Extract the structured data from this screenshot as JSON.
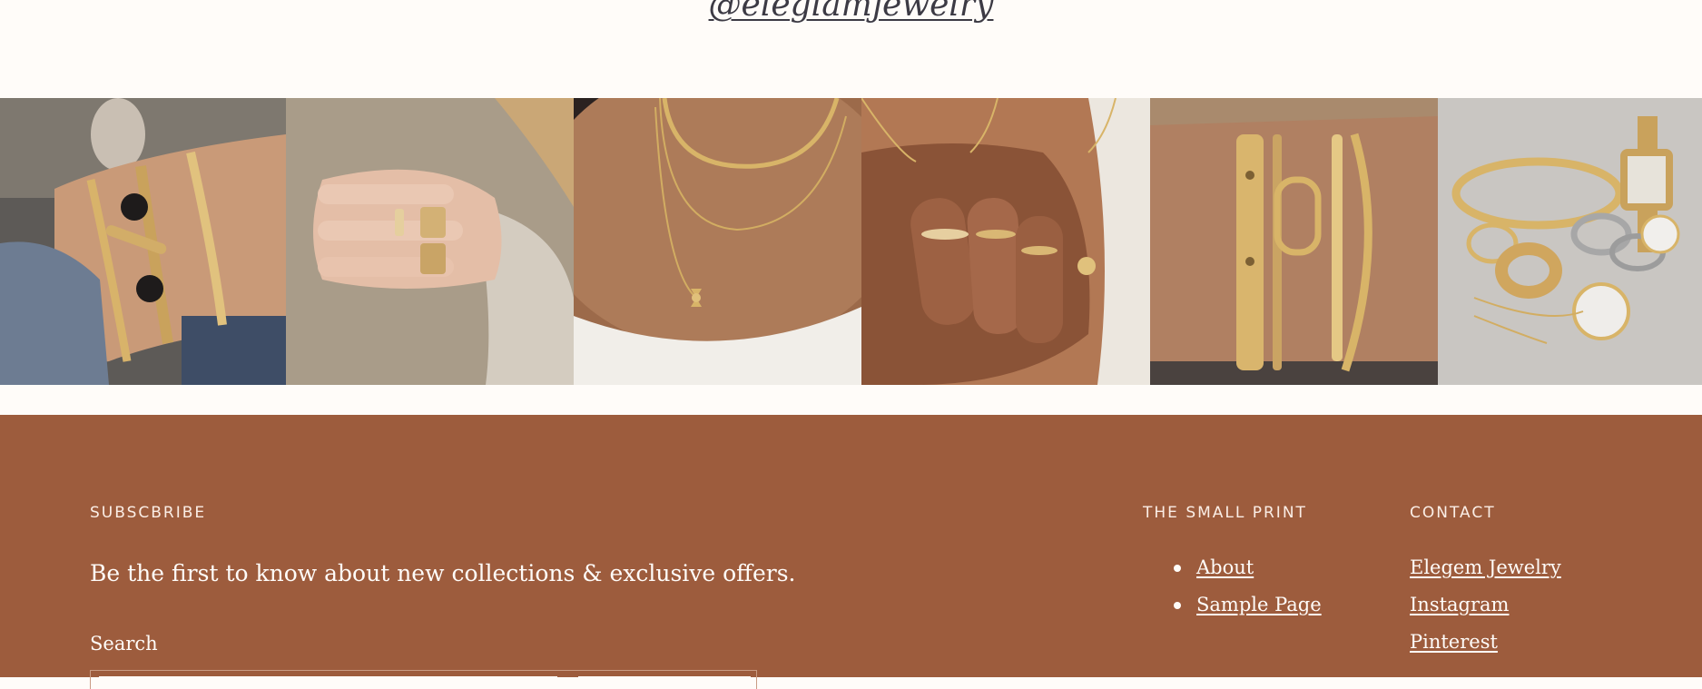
{
  "instagram": {
    "handle": "@eleglamjewelry"
  },
  "gallery": {
    "photos": [
      {
        "name": "gallery-photo-stacked-bracelets-wrist",
        "tone": "#6f6a63"
      },
      {
        "name": "gallery-photo-rings-on-sweater",
        "tone": "#b9ab98"
      },
      {
        "name": "gallery-photo-layered-necklaces",
        "tone": "#a4704f"
      },
      {
        "name": "gallery-photo-hand-with-rings",
        "tone": "#b47a57"
      },
      {
        "name": "gallery-photo-gold-bangles-wrist",
        "tone": "#a77a5e"
      },
      {
        "name": "gallery-photo-jewelry-flatlay",
        "tone": "#c8c3bd"
      }
    ]
  },
  "footer": {
    "subscribe": {
      "title": "SUBSCBRIBE",
      "text": "Be the first to know about new collections & exclusive offers.",
      "search_label": "Search"
    },
    "small_print": {
      "title": "THE SMALL PRINT",
      "links": [
        "About",
        "Sample Page"
      ]
    },
    "contact": {
      "title": "CONTACT",
      "links": [
        "Elegem Jewelry",
        "Instagram",
        "Pinterest"
      ]
    }
  },
  "colors": {
    "page_bg": "#fffcf9",
    "footer_bg": "#9d5c3d",
    "footer_text": "#fffcf9",
    "handle_text": "#3c3a44"
  }
}
